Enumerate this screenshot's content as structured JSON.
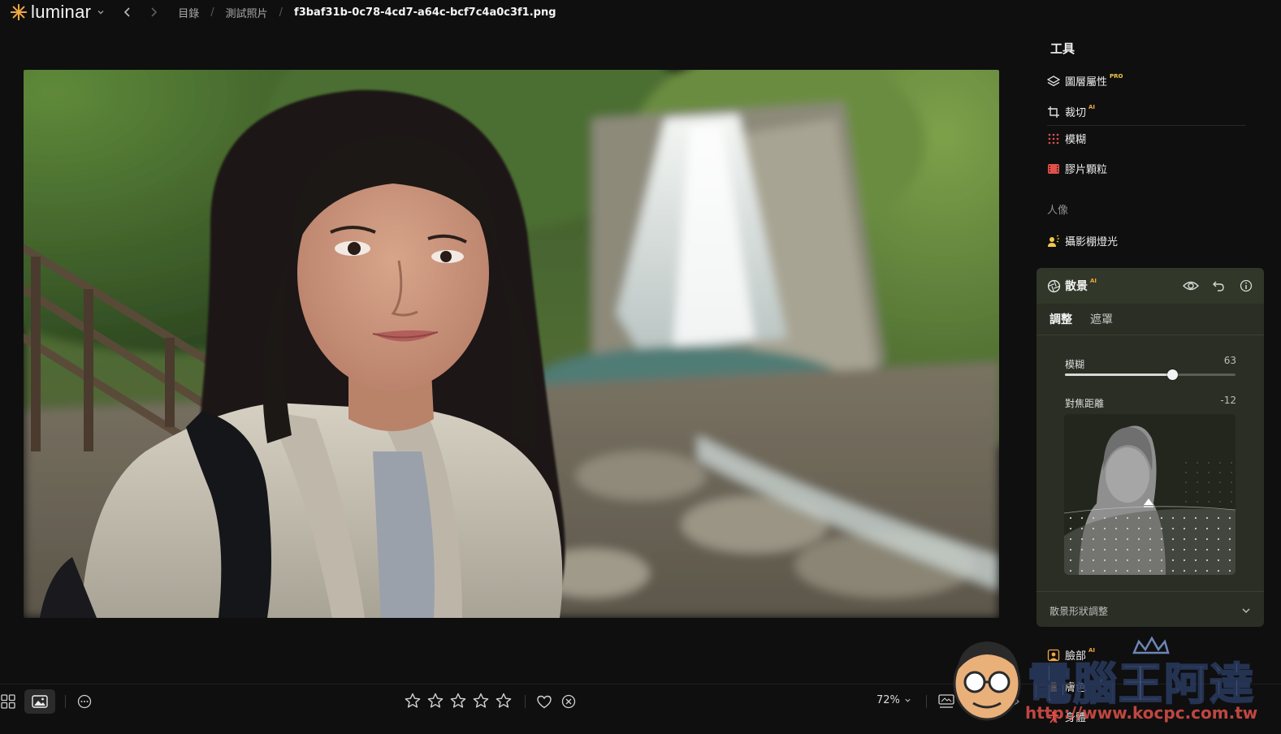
{
  "app": {
    "name": "luminar",
    "accent": "#f0a640"
  },
  "breadcrumb": {
    "items": [
      "目錄",
      "測試照片"
    ],
    "current": "f3baf31b-0c78-4cd7-a64c-bcf7c4a0c3f1.png"
  },
  "tools_panel": {
    "title": "工具",
    "items": [
      {
        "label": "圖層屬性",
        "badge": "PRO",
        "icon": "layers-icon"
      },
      {
        "label": "裁切",
        "badge": "AI",
        "icon": "crop-icon"
      },
      {
        "label": "模糊",
        "badge": "",
        "icon": "blur-icon"
      },
      {
        "label": "膠片顆粒",
        "badge": "",
        "icon": "film-grain-icon"
      }
    ],
    "portrait_section": "人像",
    "portrait_items": [
      {
        "label": "攝影棚燈光",
        "icon": "studio-light-icon"
      }
    ]
  },
  "bokeh_tool": {
    "title": "散景",
    "badge": "AI",
    "tabs": [
      "調整",
      "遮罩"
    ],
    "active_tab": 0,
    "blur": {
      "label": "模糊",
      "value": "63",
      "fraction": 0.63
    },
    "focus_distance": {
      "label": "對焦距離",
      "value": "-12"
    },
    "shape_adjust_label": "散景形狀調整"
  },
  "lower_tools": [
    {
      "label": "臉部",
      "badge": "AI",
      "icon": "face-icon"
    },
    {
      "label": "膚色",
      "badge": "",
      "icon": "skin-icon"
    },
    {
      "label": "身體",
      "badge": "",
      "icon": "body-icon"
    }
  ],
  "bottom_bar": {
    "rating_stars": 5,
    "zoom": "72%"
  },
  "watermark": {
    "text": "電腦王阿達",
    "url": "http://www.kocpc.com.tw"
  }
}
